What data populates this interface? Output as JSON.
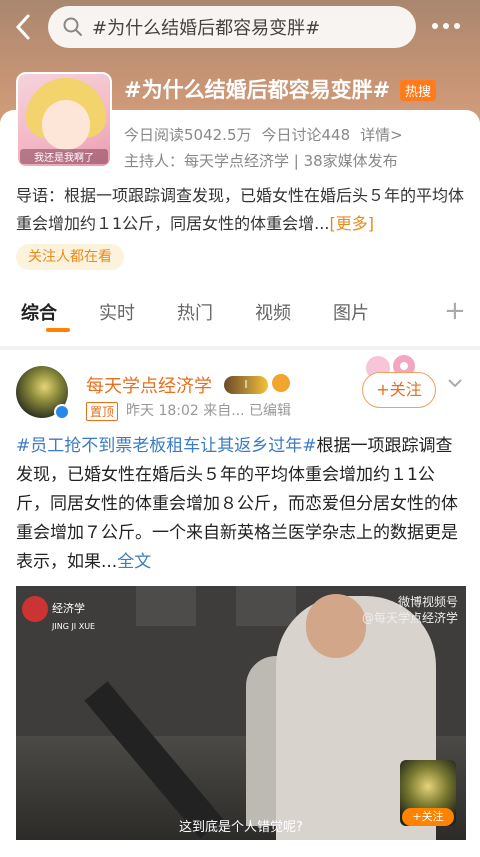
{
  "header": {
    "search_query": "#为什么结婚后都容易变胖#"
  },
  "topic": {
    "title": "#为什么结婚后都容易变胖#",
    "badge": "热搜",
    "avatar_caption": "我还是我啊了",
    "reads": "今日阅读5042.5万",
    "discussions": "今日讨论448",
    "details": "详情>",
    "host": "主持人：每天学点经济学 | 38家媒体发布",
    "guide": "导语：根据一项跟踪调查发现，已婚女性在婚后头５年的平均体重会增加约１1公斤，同居女性的体重会增...",
    "guide_more": "[更多]",
    "followed_label": "关注人都在看"
  },
  "tabs": [
    "综合",
    "实时",
    "热门",
    "视频",
    "图片"
  ],
  "post": {
    "username": "每天学点经济学",
    "level": "I",
    "pin": "置顶",
    "meta": "昨天 18:02  来自...  已编辑",
    "follow": "+关注",
    "hashtag": "#员工抢不到票老板租车让其返乡过年#",
    "body": "根据一项跟踪调查发现，已婚女性在婚后头５年的平均体重会增加约１1公斤，同居女性的体重会增加８公斤，而恋爱但分居女性的体重会增加７公斤。一个来自新英格兰医学杂志上的数据更是表示，如果...",
    "full_text": "全文"
  },
  "video": {
    "logo_text": "经济学",
    "logo_sub": "JING JI XUE",
    "watermark_1": "微博视频号",
    "watermark_2": "@每天学点经济学",
    "caption": "这到底是个人错觉呢?",
    "follow": "+关注"
  }
}
